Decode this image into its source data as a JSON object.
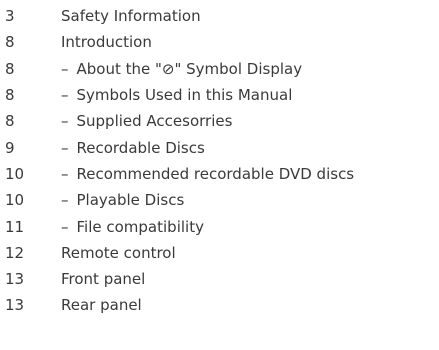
{
  "toc": {
    "entries": [
      {
        "page": "3",
        "title": "Safety Information",
        "sub": false
      },
      {
        "page": "8",
        "title": "Introduction",
        "sub": false
      },
      {
        "page": "8",
        "title": "About the \"⊘\" Symbol Display",
        "sub": true
      },
      {
        "page": "8",
        "title": "Symbols Used in this Manual",
        "sub": true
      },
      {
        "page": "8",
        "title": "Supplied Accesorries",
        "sub": true
      },
      {
        "page": "9",
        "title": "Recordable Discs",
        "sub": true
      },
      {
        "page": "10",
        "title": "Recommended recordable DVD discs",
        "sub": true
      },
      {
        "page": "10",
        "title": "Playable Discs",
        "sub": true
      },
      {
        "page": "11",
        "title": "File compatibility",
        "sub": true
      },
      {
        "page": "12",
        "title": "Remote control",
        "sub": false
      },
      {
        "page": "13",
        "title": "Front panel",
        "sub": false
      },
      {
        "page": "13",
        "title": "Rear panel",
        "sub": false
      }
    ],
    "sub_marker": "–"
  }
}
